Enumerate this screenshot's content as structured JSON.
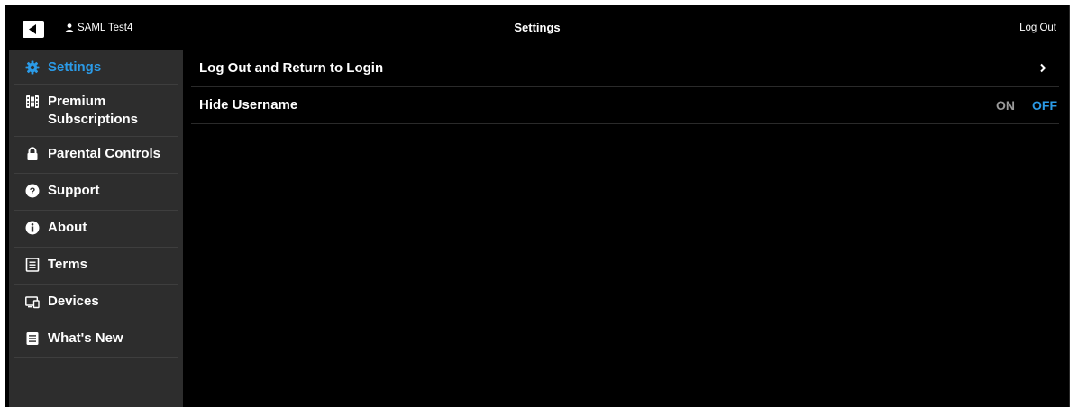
{
  "header": {
    "title": "Settings",
    "user_name": "SAML Test4",
    "logout_label": "Log Out"
  },
  "sidebar": {
    "items": [
      {
        "label": "Settings",
        "icon": "gear-icon",
        "active": true
      },
      {
        "label": "Premium Subscriptions",
        "icon": "film-icon",
        "active": false
      },
      {
        "label": "Parental Controls",
        "icon": "lock-icon",
        "active": false
      },
      {
        "label": "Support",
        "icon": "help-circle-icon",
        "active": false
      },
      {
        "label": "About",
        "icon": "info-circle-icon",
        "active": false
      },
      {
        "label": "Terms",
        "icon": "document-icon",
        "active": false
      },
      {
        "label": "Devices",
        "icon": "devices-icon",
        "active": false
      },
      {
        "label": "What's New",
        "icon": "news-icon",
        "active": false
      }
    ]
  },
  "main": {
    "rows": [
      {
        "label": "Log Out and Return to Login",
        "type": "link"
      },
      {
        "label": "Hide Username",
        "type": "toggle",
        "on_label": "ON",
        "off_label": "OFF",
        "value": "OFF"
      }
    ]
  },
  "colors": {
    "accent": "#2b9be8",
    "background": "#000000",
    "sidebar": "#2d2d2d",
    "inactive_toggle": "#9a9a9a"
  }
}
